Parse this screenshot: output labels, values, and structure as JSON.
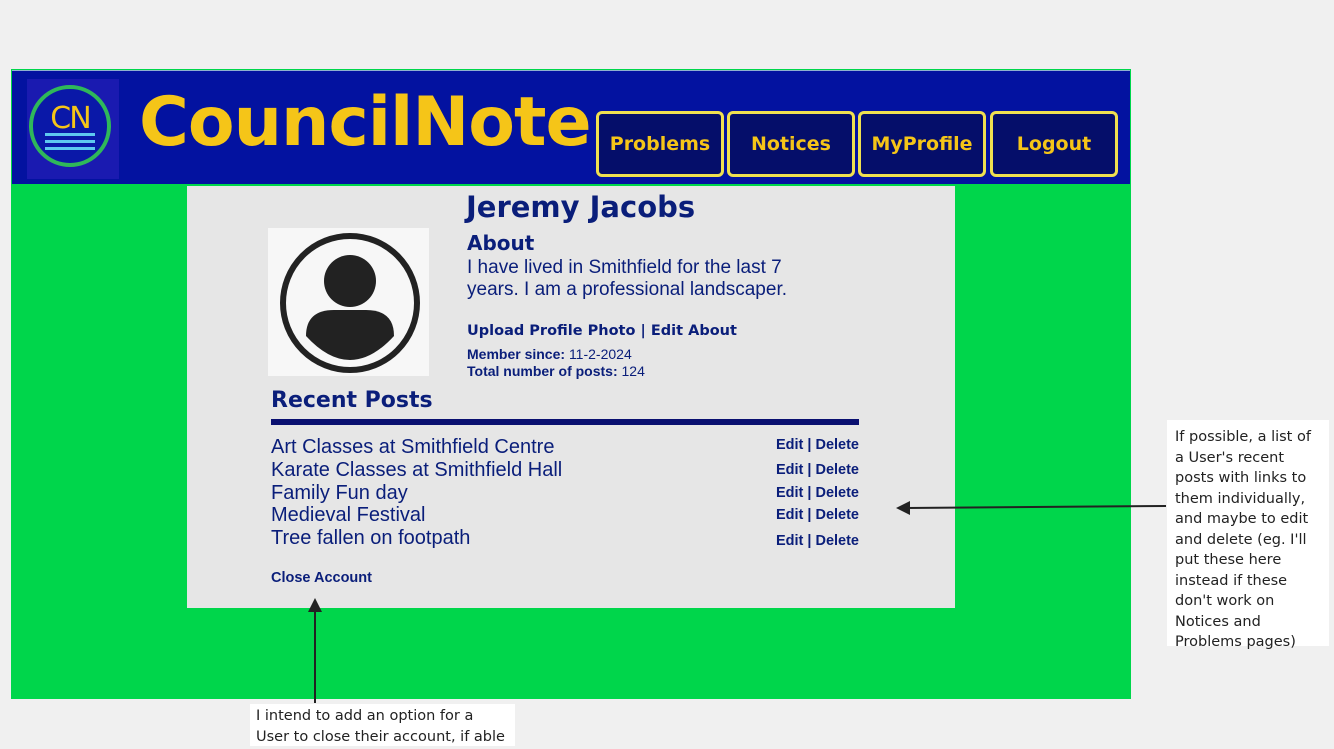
{
  "header": {
    "logo_text": "CN",
    "brand": "CouncilNote",
    "nav": [
      "Problems",
      "Notices",
      "MyProfile",
      "Logout"
    ]
  },
  "profile": {
    "name": "Jeremy Jacobs",
    "about_heading": "About",
    "about_text": "I have lived in Smithfield for the last 7 years. I am a professional landscaper.",
    "upload_link": "Upload Profile Photo",
    "separator": "|",
    "edit_about_link": "Edit About",
    "member_since_label": "Member since:",
    "member_since_value": "11-2-2024",
    "total_posts_label": "Total number of posts:",
    "total_posts_value": "124"
  },
  "recent_posts": {
    "heading": "Recent Posts",
    "edit_label": "Edit",
    "separator": "|",
    "delete_label": "Delete",
    "items": [
      "Art Classes at Smithfield Centre",
      "Karate Classes at Smithfield Hall",
      "Family Fun day",
      "Medieval Festival",
      "Tree fallen on footpath"
    ]
  },
  "close_account": "Close Account",
  "annotations": {
    "right_note": "If possible, a list of a User's recent posts with links to them individually, and maybe to edit and delete (eg. I'll put these here instead if these don't work on Notices and Problems pages)",
    "bottom_note": "I intend to add an option for a User to close their account, if able"
  },
  "colors": {
    "header_bg": "#0312a0",
    "brand_yellow": "#f5c518",
    "canvas_green": "#00d64b",
    "panel_gray": "#e6e6e6",
    "text_navy": "#0a1e7a"
  },
  "icons": [
    "council-note-logo-icon",
    "user-avatar-icon",
    "arrow-left-icon",
    "arrow-up-icon"
  ]
}
